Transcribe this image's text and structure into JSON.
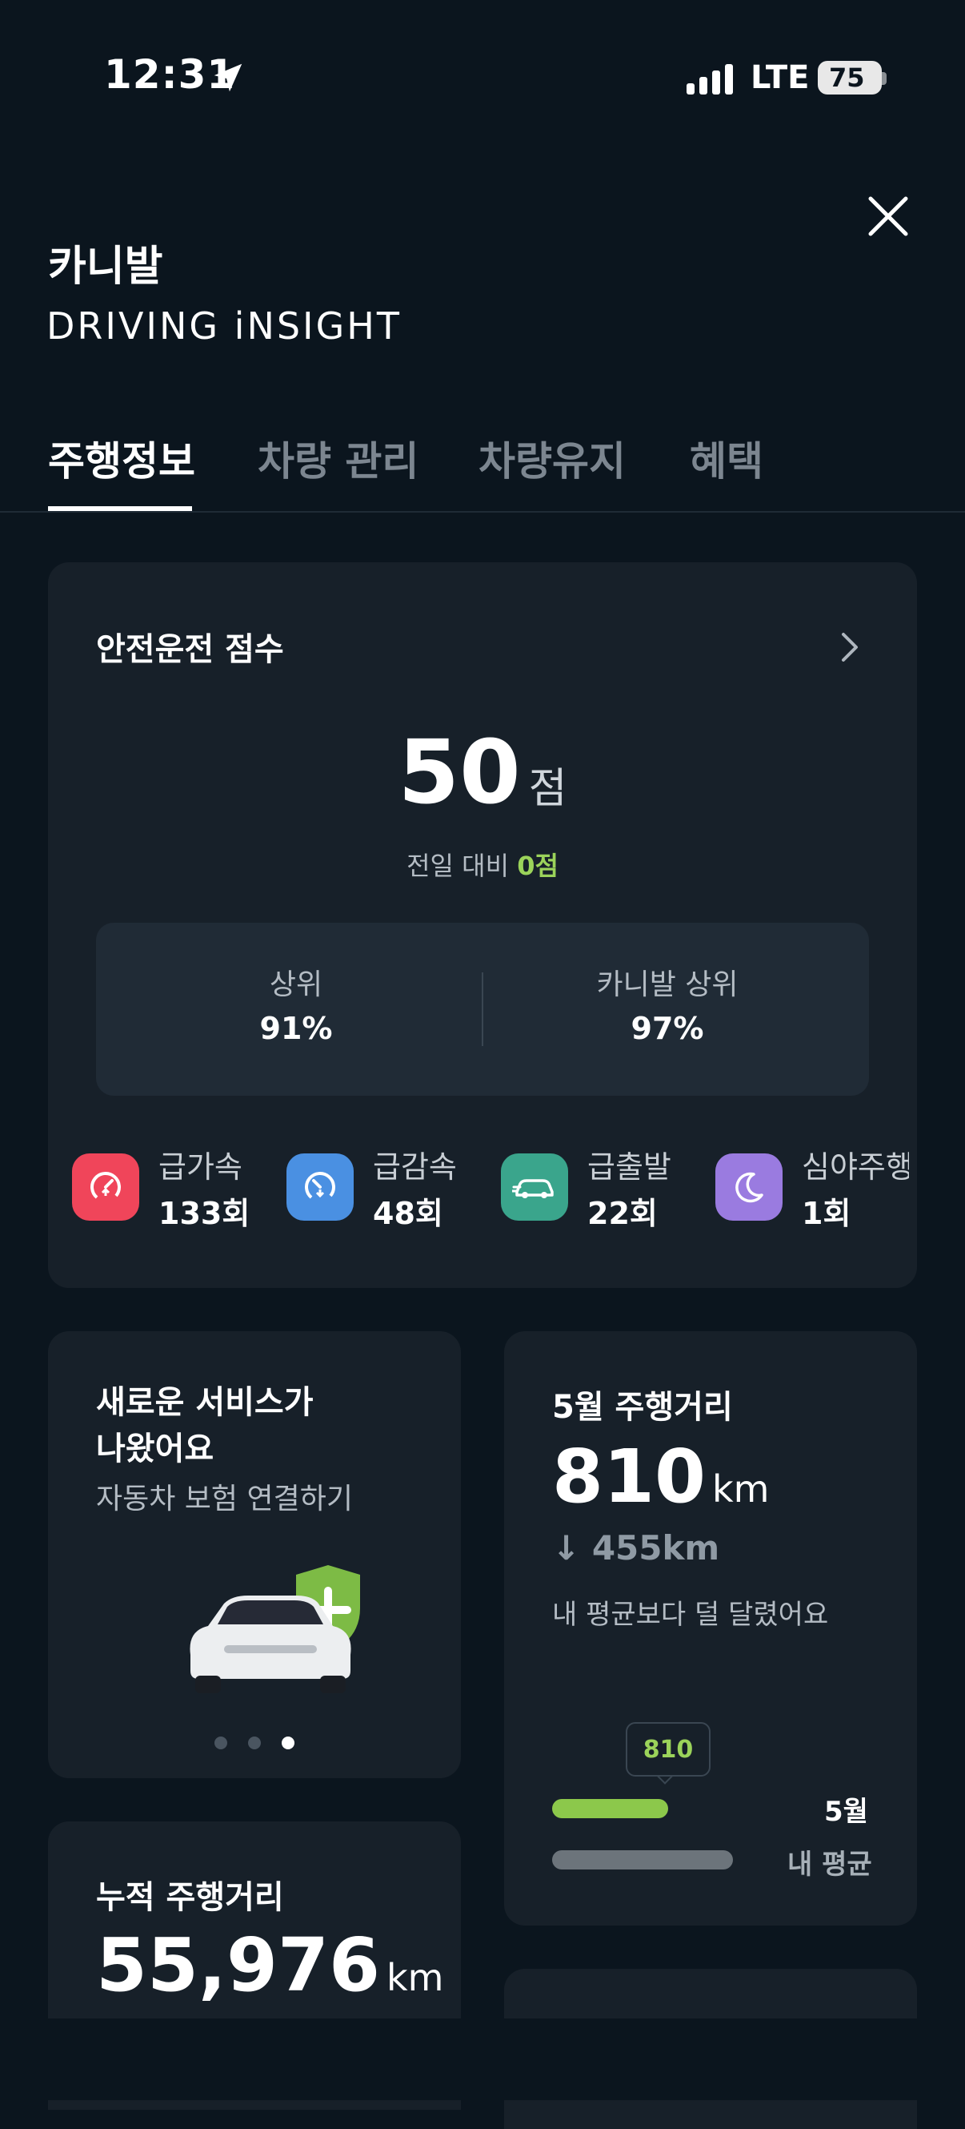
{
  "status_bar": {
    "time": "12:31",
    "network": "LTE",
    "battery": "75"
  },
  "header": {
    "brand": "카니발",
    "subtitle": "DRIVING iNSIGHT"
  },
  "tabs": [
    {
      "label": "주행정보",
      "active": true
    },
    {
      "label": "차량 관리",
      "active": false
    },
    {
      "label": "차량유지",
      "active": false
    },
    {
      "label": "혜택",
      "active": false
    }
  ],
  "safety": {
    "title": "안전운전 점수",
    "score": "50",
    "score_unit": "점",
    "compare_prefix": "전일 대비",
    "compare_value": "0점",
    "ranks": [
      {
        "label": "상위",
        "value": "91%"
      },
      {
        "label": "카니발 상위",
        "value": "97%"
      }
    ],
    "events": [
      {
        "label": "급가속",
        "count": "133회",
        "icon": "rapid-acceleration-icon",
        "color": "#f0455a"
      },
      {
        "label": "급감속",
        "count": "48회",
        "icon": "rapid-deceleration-icon",
        "color": "#4a90e2"
      },
      {
        "label": "급출발",
        "count": "22회",
        "icon": "rapid-start-icon",
        "color": "#3aa58c"
      },
      {
        "label": "심야주행",
        "count": "1회",
        "icon": "night-driving-icon",
        "color": "#9a7be0"
      }
    ]
  },
  "promo": {
    "title_line1": "새로운 서비스가",
    "title_line2": "나왔어요",
    "subtitle": "자동차 보험 연결하기",
    "page_count": 3,
    "active_page": 3
  },
  "monthly": {
    "title": "5월 주행거리",
    "value": "810",
    "unit": "km",
    "diff": "↓ 455km",
    "note": "내 평균보다 덜 달렸어요",
    "bubble": "810",
    "bar_labels": [
      "5월",
      "내 평균"
    ],
    "month_km": 810,
    "avg_km": 1265
  },
  "cumulative": {
    "title": "누적 주행거리",
    "value": "55,976",
    "unit": "km"
  },
  "colors": {
    "background": "#0b151e",
    "card": "#172029",
    "accent_green": "#9bd35a"
  }
}
